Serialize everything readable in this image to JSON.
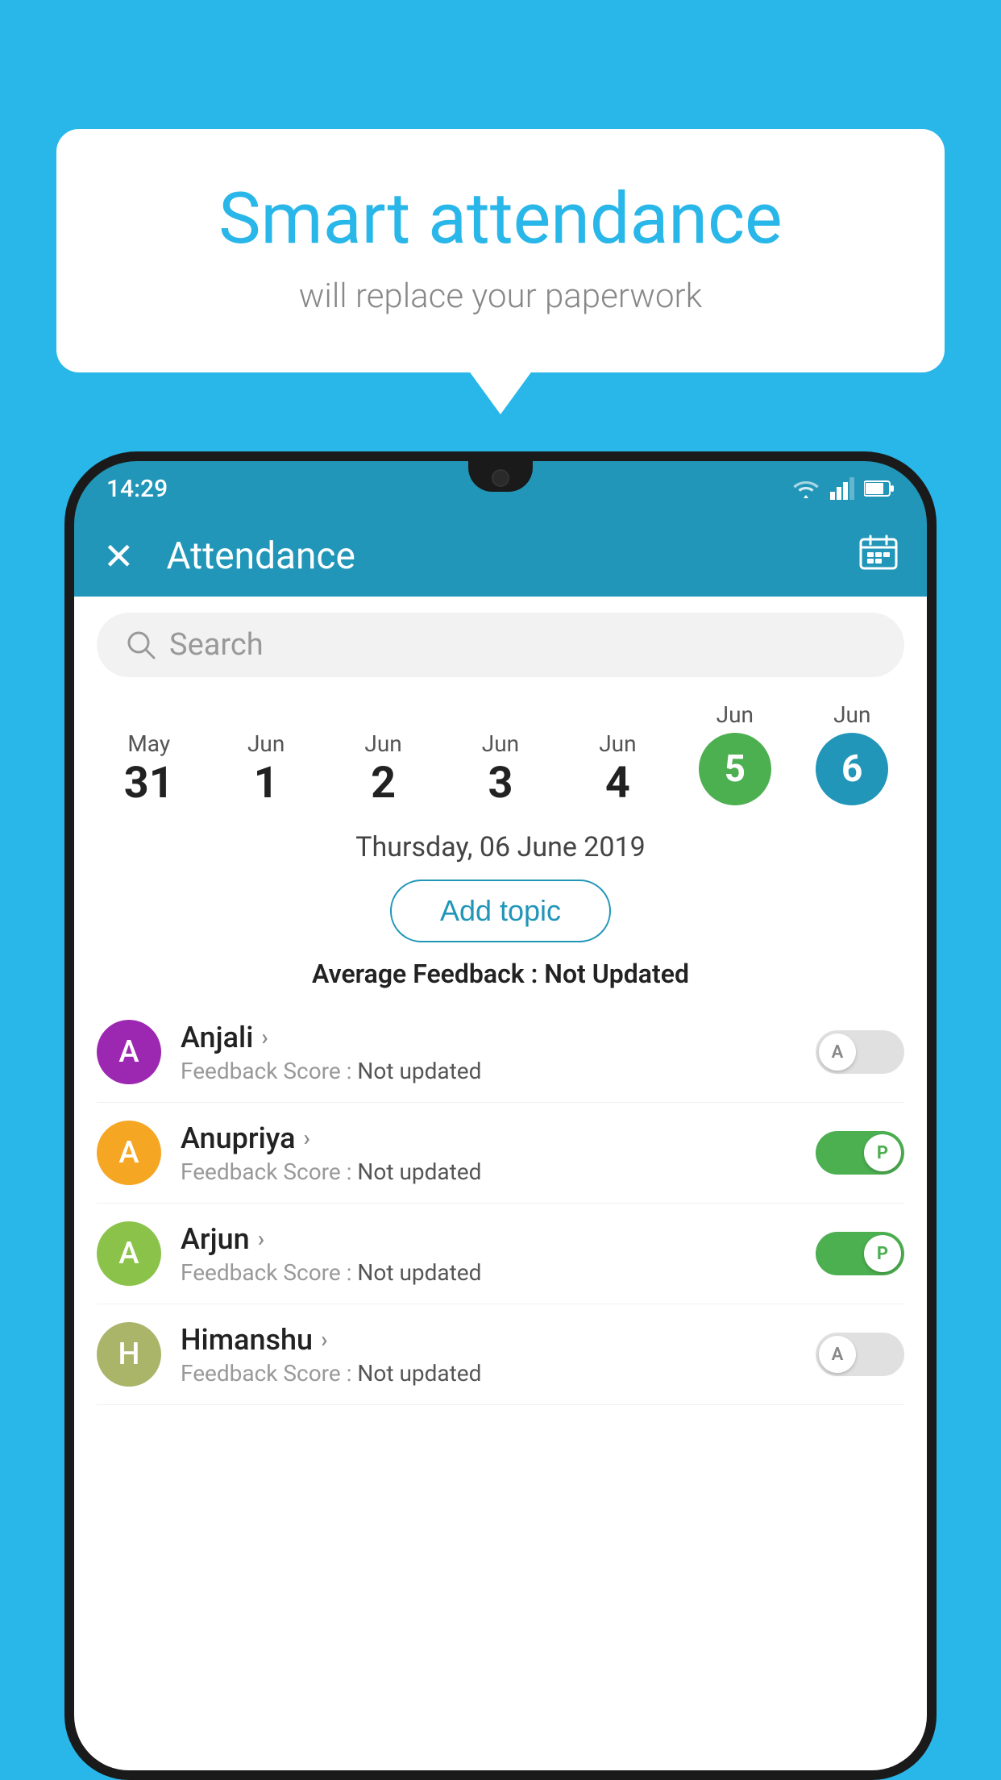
{
  "background_color": "#29b6e8",
  "speech_bubble": {
    "heading": "Smart attendance",
    "subtext": "will replace your paperwork"
  },
  "status_bar": {
    "time": "14:29",
    "icons": [
      "wifi",
      "signal",
      "battery"
    ]
  },
  "app_header": {
    "title": "Attendance",
    "close_label": "×",
    "calendar_icon": "📅"
  },
  "search": {
    "placeholder": "Search"
  },
  "date_strip": {
    "dates": [
      {
        "month": "May",
        "day": "31",
        "state": "normal"
      },
      {
        "month": "Jun",
        "day": "1",
        "state": "normal"
      },
      {
        "month": "Jun",
        "day": "2",
        "state": "normal"
      },
      {
        "month": "Jun",
        "day": "3",
        "state": "normal"
      },
      {
        "month": "Jun",
        "day": "4",
        "state": "normal"
      },
      {
        "month": "Jun",
        "day": "5",
        "state": "today"
      },
      {
        "month": "Jun",
        "day": "6",
        "state": "selected"
      }
    ]
  },
  "selected_date_label": "Thursday, 06 June 2019",
  "add_topic_label": "Add topic",
  "avg_feedback_label": "Average Feedback :",
  "avg_feedback_value": "Not Updated",
  "students": [
    {
      "name": "Anjali",
      "avatar_letter": "A",
      "avatar_color": "#9c27b0",
      "feedback_label": "Feedback Score :",
      "feedback_value": "Not updated",
      "toggle_state": "off",
      "toggle_letter": "A"
    },
    {
      "name": "Anupriya",
      "avatar_letter": "A",
      "avatar_color": "#f5a623",
      "feedback_label": "Feedback Score :",
      "feedback_value": "Not updated",
      "toggle_state": "on",
      "toggle_letter": "P"
    },
    {
      "name": "Arjun",
      "avatar_letter": "A",
      "avatar_color": "#8bc34a",
      "feedback_label": "Feedback Score :",
      "feedback_value": "Not updated",
      "toggle_state": "on",
      "toggle_letter": "P"
    },
    {
      "name": "Himanshu",
      "avatar_letter": "H",
      "avatar_color": "#aab56a",
      "feedback_label": "Feedback Score :",
      "feedback_value": "Not updated",
      "toggle_state": "off",
      "toggle_letter": "A"
    }
  ]
}
